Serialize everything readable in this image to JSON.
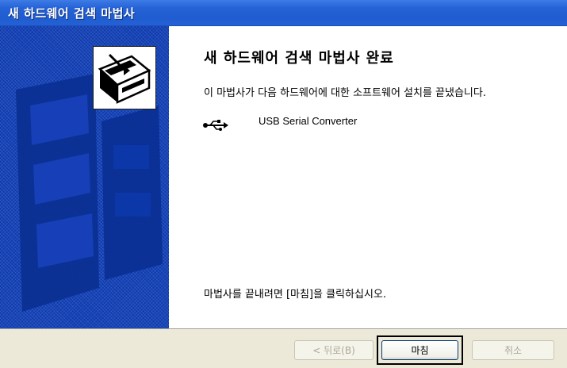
{
  "window": {
    "title": "새 하드웨어 검색 마법사"
  },
  "content": {
    "heading": "새 하드웨어 검색 마법사 완료",
    "description": "이 마법사가 다음 하드웨어에 대한 소프트웨어 설치를 끝냈습니다.",
    "device_name": "USB Serial Converter",
    "device_icon": "usb-icon",
    "finish_note": "마법사를 끝내려면 [마침]을 클릭하십시오."
  },
  "buttons": {
    "back": "< 뒤로(B)",
    "finish": "마침",
    "cancel": "취소"
  },
  "banner": {
    "icon": "hardware-box-icon"
  },
  "colors": {
    "title_bar": "#2663d8",
    "banner": "#0d3bb0",
    "button_bar": "#ece9d8"
  }
}
